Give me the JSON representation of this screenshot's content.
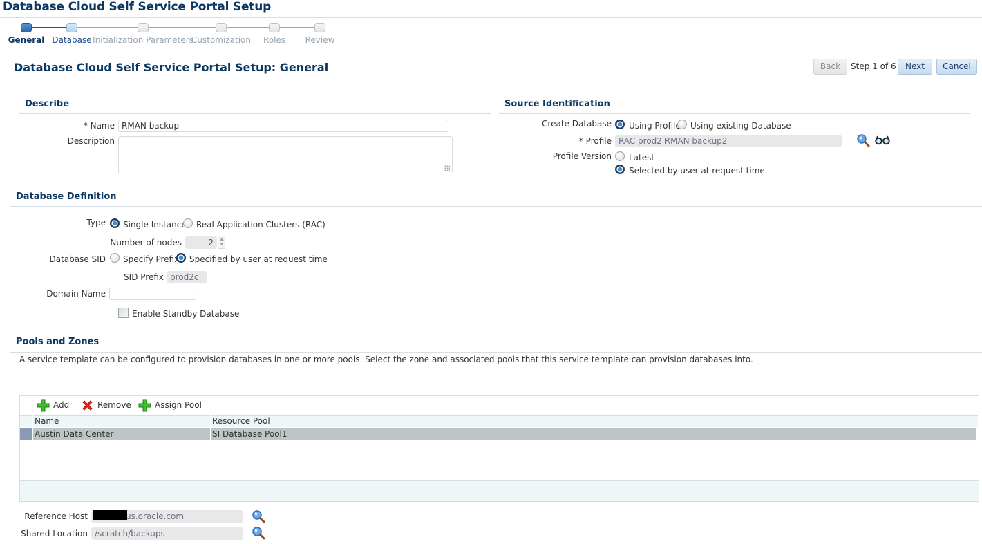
{
  "app": {
    "title": "Database Cloud Self Service Portal Setup"
  },
  "train": {
    "steps": [
      {
        "label": "General",
        "state": "current"
      },
      {
        "label": "Database",
        "state": "visited"
      },
      {
        "label": "Initialization Parameters",
        "state": "todo"
      },
      {
        "label": "Customization",
        "state": "todo"
      },
      {
        "label": "Roles",
        "state": "todo"
      },
      {
        "label": "Review",
        "state": "todo"
      }
    ]
  },
  "page": {
    "title": "Database Cloud Self Service Portal Setup: General"
  },
  "nav": {
    "back_label": "Back",
    "step_text": "Step 1 of 6",
    "next_label": "Next",
    "cancel_label": "Cancel"
  },
  "describe": {
    "header": "Describe",
    "name_label": "* Name",
    "name_value": "RMAN backup",
    "description_label": "Description",
    "description_value": ""
  },
  "source": {
    "header": "Source Identification",
    "create_db_label": "Create Database",
    "create_db_options": [
      {
        "label": "Using Profile",
        "selected": true
      },
      {
        "label": "Using existing Database",
        "selected": false
      }
    ],
    "profile_label": "* Profile",
    "profile_value": "RAC prod2 RMAN backup2",
    "search_icon": "search-icon",
    "view_icon": "glasses-icon",
    "profile_version_label": "Profile Version",
    "profile_version_options": [
      {
        "label": "Latest",
        "selected": false
      },
      {
        "label": "Selected by user at request time",
        "selected": true
      }
    ]
  },
  "definition": {
    "header": "Database Definition",
    "type_label": "Type",
    "type_options": [
      {
        "label": "Single Instance",
        "selected": true
      },
      {
        "label": "Real Application Clusters (RAC)",
        "selected": false
      }
    ],
    "nodes_label": "Number of nodes",
    "nodes_value": "2",
    "sid_label": "Database SID",
    "sid_options": [
      {
        "label": "Specify Prefix",
        "selected": false
      },
      {
        "label": "Specified by user at request time",
        "selected": true
      }
    ],
    "sid_prefix_label": "SID Prefix",
    "sid_prefix_value": "prod2c",
    "domain_label": "Domain Name",
    "domain_value": "",
    "standby_label": "Enable Standby Database",
    "standby_checked": false
  },
  "pools": {
    "header": "Pools and Zones",
    "description": "A service template can be configured to provision databases in one or more pools. Select the zone and associated pools that this service template can provision databases into.",
    "toolbar": {
      "add_label": "Add",
      "remove_label": "Remove",
      "assign_label": "Assign Pool"
    },
    "columns": [
      "Name",
      "Resource Pool"
    ],
    "rows": [
      {
        "name": "Austin Data Center",
        "pool": "SI Database Pool1",
        "selected": true
      }
    ]
  },
  "reference": {
    "host_label": "Reference Host",
    "host_value": "us.oracle.com",
    "location_label": "Shared Location",
    "location_value": "/scratch/backups"
  }
}
